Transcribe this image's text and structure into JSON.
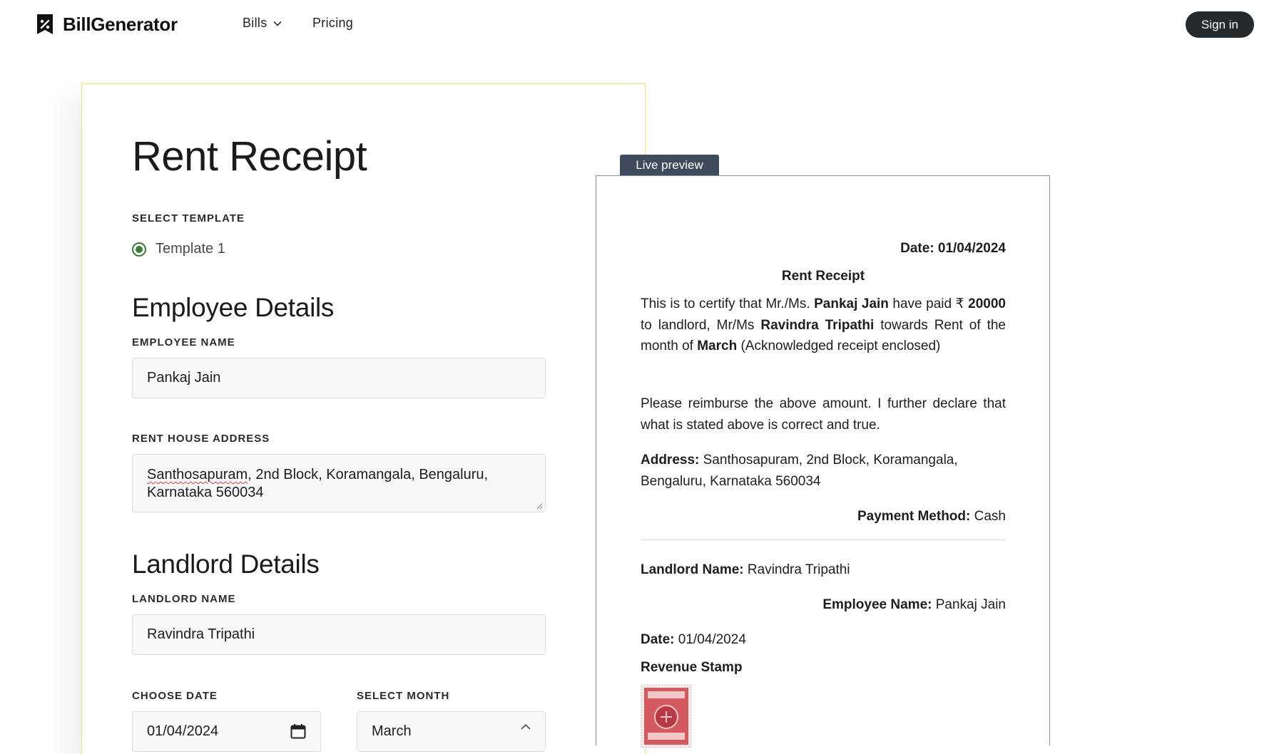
{
  "header": {
    "brand": "BillGenerator",
    "nav_bills": "Bills",
    "nav_pricing": "Pricing",
    "signin": "Sign in"
  },
  "form": {
    "title": "Rent Receipt",
    "template_label": "SELECT TEMPLATE",
    "template_option": "Template 1",
    "employee_heading": "Employee Details",
    "employee_name_label": "EMPLOYEE NAME",
    "employee_name_value": "Pankaj Jain",
    "address_label": "RENT HOUSE ADDRESS",
    "address_line1_word": "Santhosapuram",
    "address_line1_rest": ", 2nd Block, Koramangala, Bengaluru,",
    "address_line2": "Karnataka 560034",
    "landlord_heading": "Landlord Details",
    "landlord_name_label": "LANDLORD NAME",
    "landlord_name_value": "Ravindra Tripathi",
    "date_label": "CHOOSE DATE",
    "date_value": "01/04/2024",
    "month_label": "SELECT MONTH",
    "month_value": "March"
  },
  "preview": {
    "tab": "Live preview",
    "date_top": "Date: 01/04/2024",
    "heading": "Rent Receipt",
    "p1_a": "This is to certify that Mr./Ms. ",
    "p1_name": "Pankaj Jain",
    "p1_b": " have paid ₹ ",
    "p1_amount": "20000",
    "p1_c": " to landlord, Mr/Ms ",
    "p1_landlord": "Ravindra Tripathi",
    "p1_d": " towards Rent of the month of ",
    "p1_month": "March",
    "p1_e": " (Acknowledged receipt enclosed)",
    "p2": "Please reimburse the above amount. I further declare that what is stated above is correct and true.",
    "address_label": "Address:",
    "address_value": " Santhosapuram, 2nd Block, Koramangala, Bengaluru, Karnataka 560034",
    "payment_label": "Payment Method:",
    "payment_value": " Cash",
    "landlord_label": "Landlord Name:",
    "landlord_value": " Ravindra Tripathi",
    "employee_label": "Employee Name:",
    "employee_value": " Pankaj Jain",
    "date_label": "Date:",
    "date_value": " 01/04/2024",
    "stamp_label": "Revenue Stamp"
  },
  "colors": {
    "brand_dark": "#252a2f",
    "radio_green": "#3c7a3a",
    "preview_tab": "#3d4b5c",
    "form_card_border": "#f1e27a",
    "stamp_red": "#c8404a"
  }
}
